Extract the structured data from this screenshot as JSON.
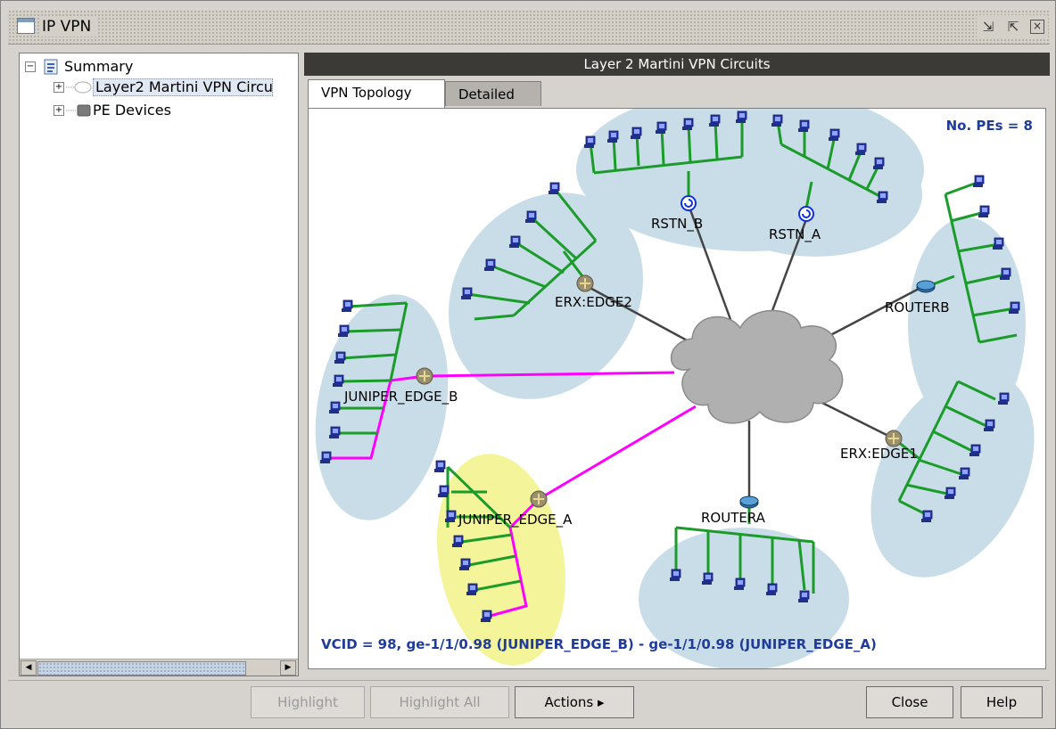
{
  "window": {
    "title": "IP VPN"
  },
  "tree": {
    "items": [
      {
        "label": "Summary"
      },
      {
        "label": "Layer2 Martini VPN Circu"
      },
      {
        "label": "PE Devices"
      }
    ]
  },
  "panel": {
    "header": "Layer 2 Martini VPN Circuits",
    "tabs": [
      {
        "label": "VPN Topology"
      },
      {
        "label": "Detailed"
      }
    ]
  },
  "topology": {
    "pe_count_label": "No. PEs = 8",
    "nodes": [
      {
        "name": "RSTN_B"
      },
      {
        "name": "RSTN_A"
      },
      {
        "name": "ERX:EDGE2"
      },
      {
        "name": "ROUTERB"
      },
      {
        "name": "JUNIPER_EDGE_B"
      },
      {
        "name": "ERX:EDGE1"
      },
      {
        "name": "JUNIPER_EDGE_A"
      },
      {
        "name": "ROUTERA"
      }
    ],
    "vcid_label": "VCID = 98, ge-1/1/0.98 (JUNIPER_EDGE_B) - ge-1/1/0.98 (JUNIPER_EDGE_A)",
    "colors": {
      "cluster": "#c9dde8",
      "highlight_cluster": "#f4f59a",
      "circuit": "#ff00ff",
      "access": "#1a9b2a",
      "link": "#444444",
      "cloud": "#b0b0b0"
    }
  },
  "buttons": {
    "highlight": "Highlight",
    "highlight_all": "Highlight All",
    "actions": "Actions ▸",
    "close": "Close",
    "help": "Help"
  }
}
